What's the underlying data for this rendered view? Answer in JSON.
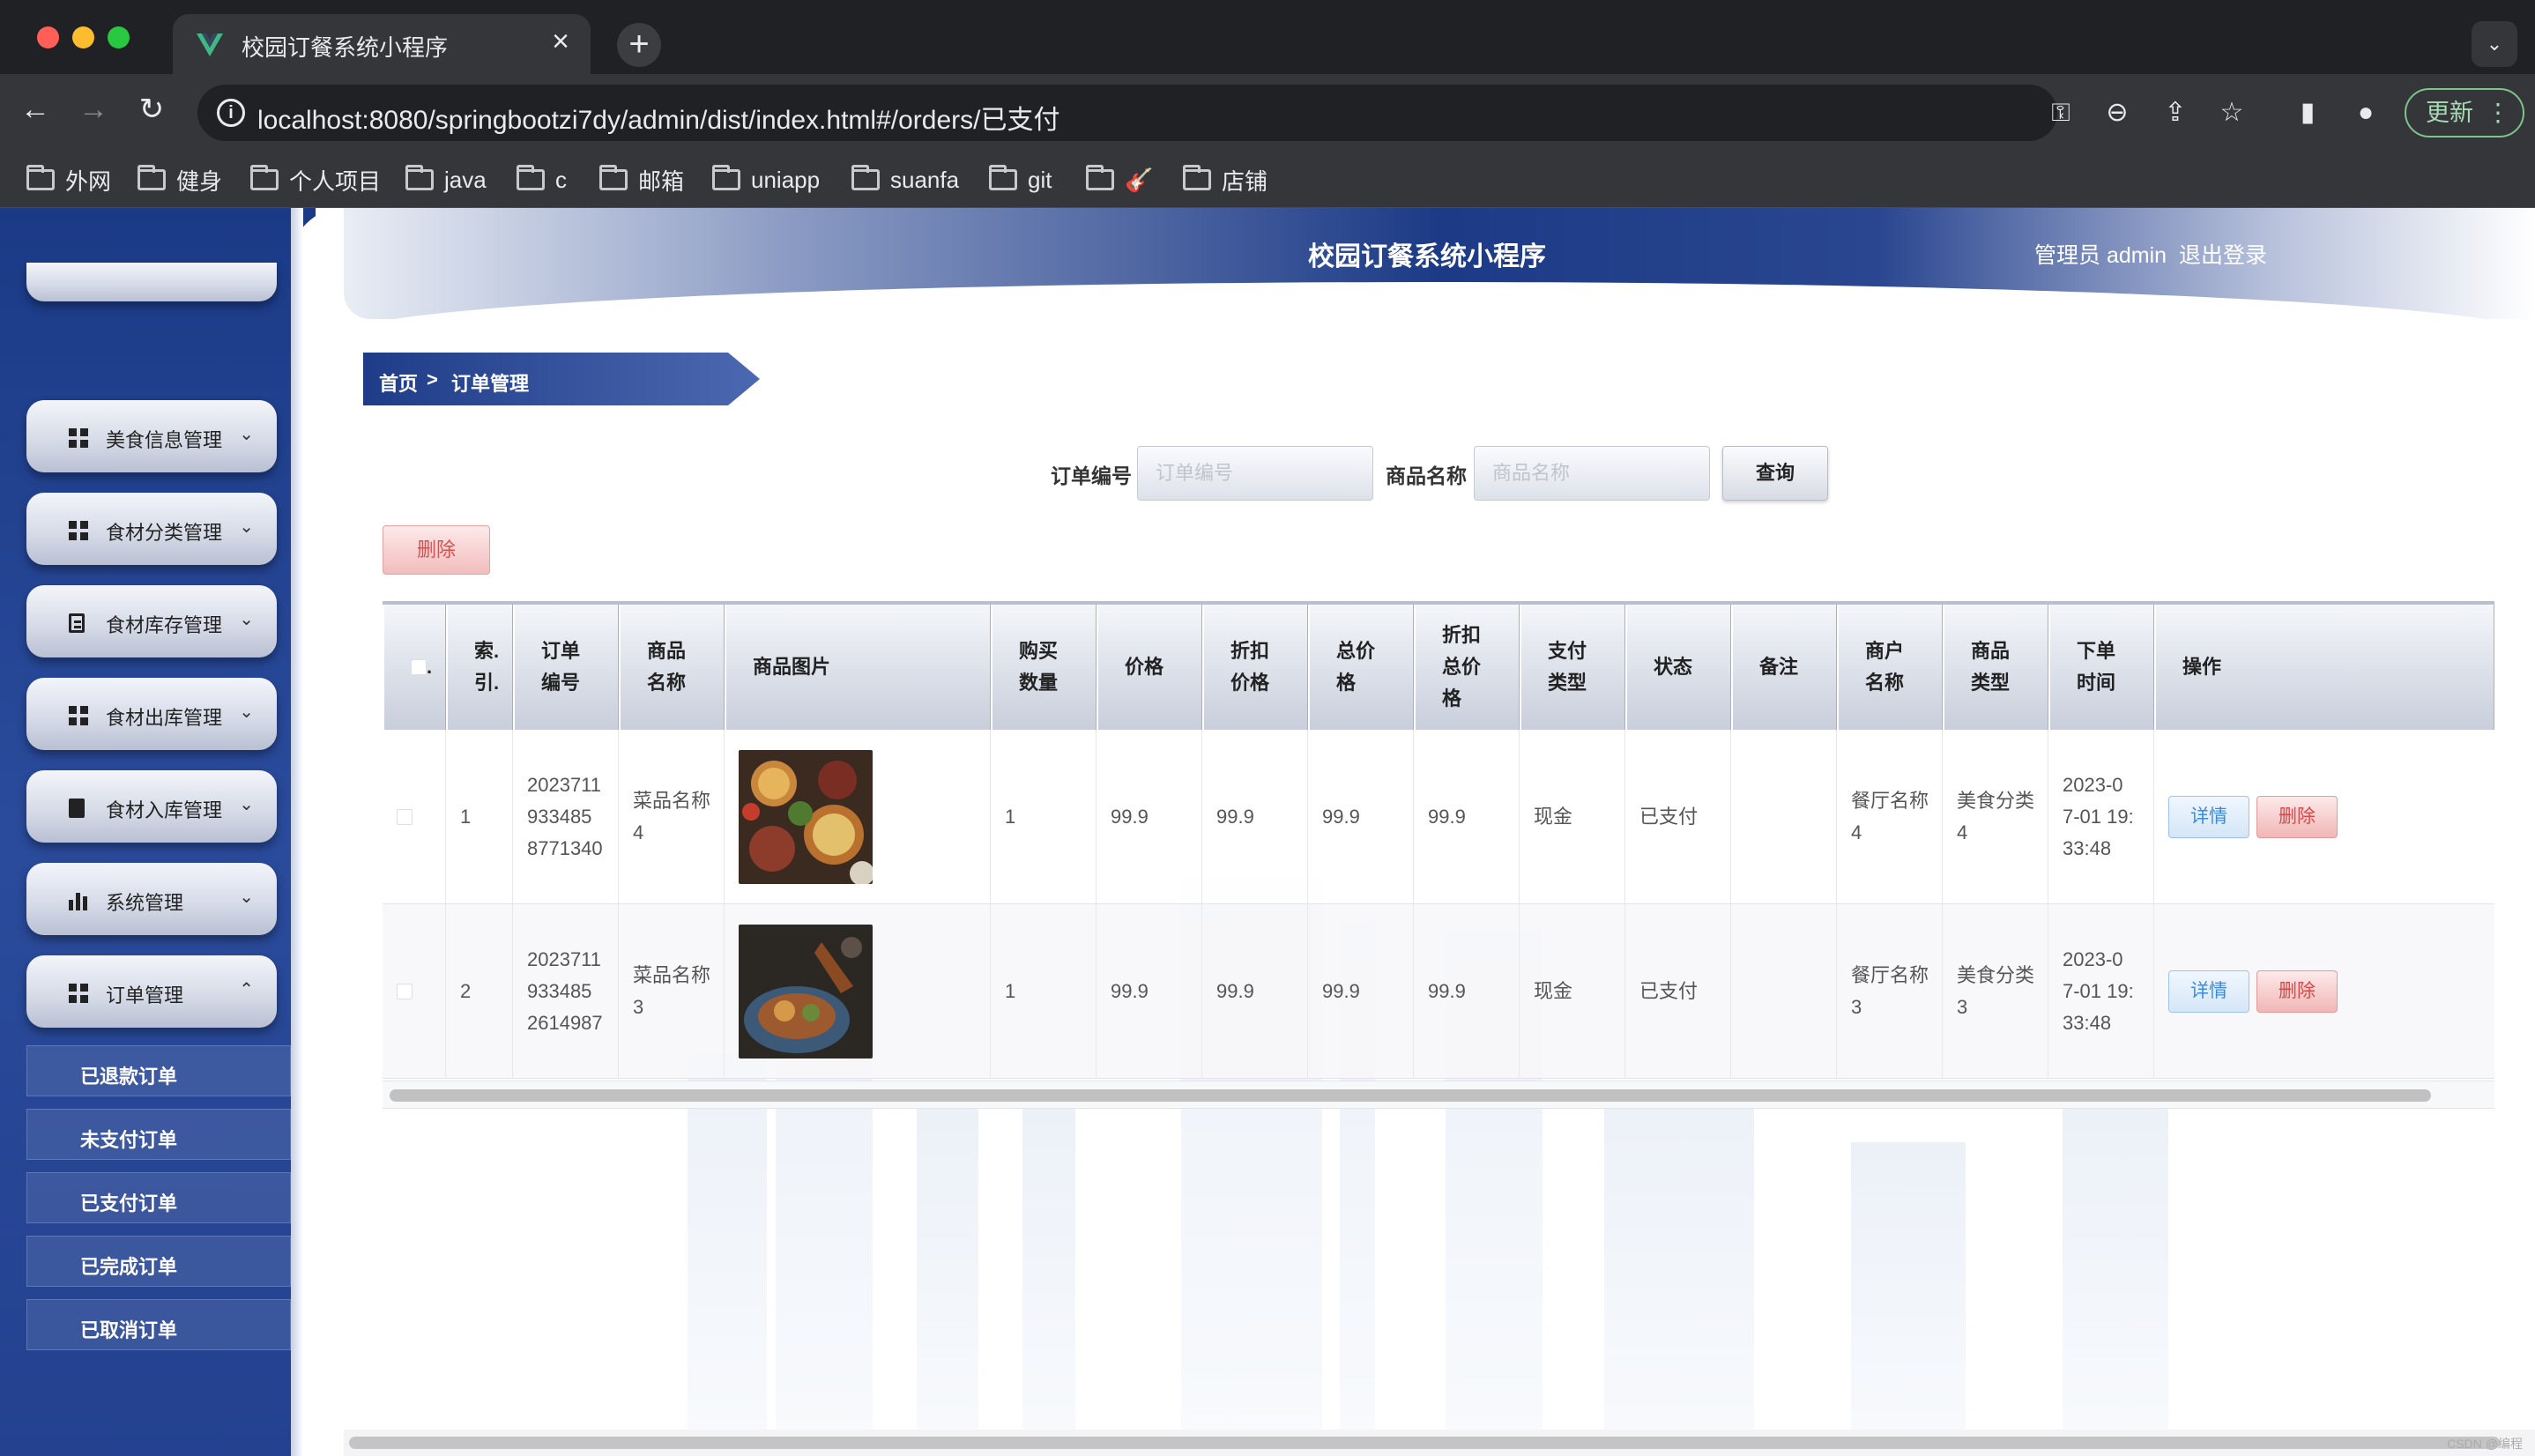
{
  "browser": {
    "tab_title": "校园订餐系统小程序",
    "url": "localhost:8080/springbootzi7dy/admin/dist/index.html#/orders/已支付",
    "update_label": "更新",
    "bookmarks": [
      "外网",
      "健身",
      "个人项目",
      "java",
      "c",
      "邮箱",
      "uniapp",
      "suanfa",
      "git",
      "🎸",
      "店铺"
    ]
  },
  "header": {
    "title": "校园订餐系统小程序",
    "admin": "管理员 admin",
    "logout": "退出登录"
  },
  "sidebar": {
    "items": [
      {
        "label": "美食信息管理",
        "icon": "grid-icon",
        "chevron": "⌄"
      },
      {
        "label": "食材分类管理",
        "icon": "grid-icon",
        "chevron": "⌄"
      },
      {
        "label": "食材库存管理",
        "icon": "document-icon",
        "chevron": "⌄"
      },
      {
        "label": "食材出库管理",
        "icon": "grid-icon",
        "chevron": "⌄"
      },
      {
        "label": "食材入库管理",
        "icon": "clipboard-check-icon",
        "chevron": "⌄"
      },
      {
        "label": "系统管理",
        "icon": "bar-chart-icon",
        "chevron": "⌄"
      },
      {
        "label": "订单管理",
        "icon": "grid-icon",
        "chevron": "⌃"
      }
    ],
    "submenu": [
      "已退款订单",
      "未支付订单",
      "已支付订单",
      "已完成订单",
      "已取消订单"
    ]
  },
  "breadcrumb": {
    "home": "首页",
    "sep": ">",
    "current": "订单管理"
  },
  "search": {
    "order_label": "订单编号",
    "order_placeholder": "订单编号",
    "product_label": "商品名称",
    "product_placeholder": "商品名称",
    "query": "查询"
  },
  "actions": {
    "delete": "删除"
  },
  "table": {
    "headers": [
      "索引",
      "订单编号",
      "商品名称",
      "商品图片",
      "购买数量",
      "价格",
      "折扣价格",
      "总价格",
      "折扣总价格",
      "支付类型",
      "状态",
      "备注",
      "商户名称",
      "商品类型",
      "下单时间",
      "操作"
    ],
    "header_display": {
      "check": ".",
      "index": "索.\n引.",
      "order_no": "订单\n编号",
      "name": "商品\n名称",
      "image": "商品图片",
      "qty": "购买\n数量",
      "price": "价格",
      "discount_price": "折扣\n价格",
      "total": "总价\n格",
      "discount_total": "折扣\n总价\n格",
      "pay_type": "支付\n类型",
      "status": "状态",
      "remark": "备注",
      "merchant": "商户\n名称",
      "category": "商品\n类型",
      "time": "下单\n时间",
      "ops": "操作"
    },
    "rows": [
      {
        "index": "1",
        "order_no": "2023711\n933485\n8771340",
        "name": "菜品名称\n4",
        "qty": "1",
        "price": "99.9",
        "discount_price": "99.9",
        "total": "99.9",
        "discount_total": "99.9",
        "pay_type": "现金",
        "status": "已支付",
        "remark": "",
        "merchant": "餐厅名称\n4",
        "category": "美食分类\n4",
        "time": "2023-0\n7-01 19:\n33:48",
        "detail": "详情",
        "delete": "删除"
      },
      {
        "index": "2",
        "order_no": "2023711\n933485\n2614987",
        "name": "菜品名称\n3",
        "qty": "1",
        "price": "99.9",
        "discount_price": "99.9",
        "total": "99.9",
        "discount_total": "99.9",
        "pay_type": "现金",
        "status": "已支付",
        "remark": "",
        "merchant": "餐厅名称\n3",
        "category": "美食分类\n3",
        "time": "2023-0\n7-01 19:\n33:48",
        "detail": "详情",
        "delete": "删除"
      }
    ]
  },
  "watermark": "CSDN @编程"
}
